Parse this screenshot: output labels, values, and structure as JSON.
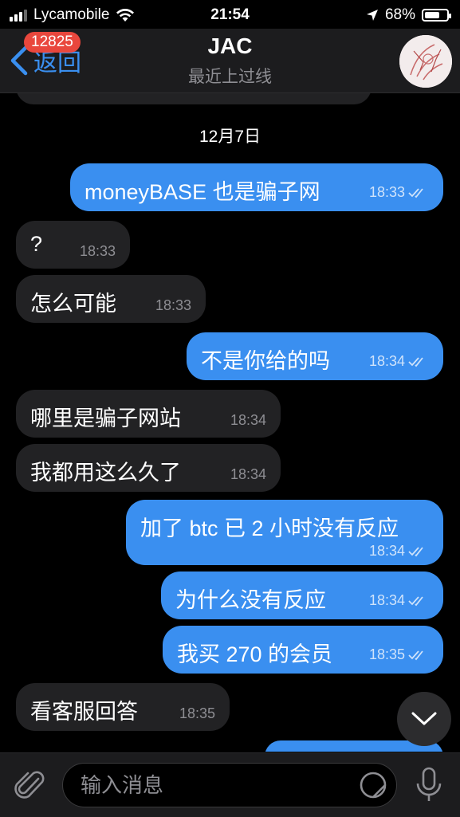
{
  "status": {
    "carrier": "Lycamobile",
    "time": "21:54",
    "battery": "68%",
    "battery_level": 0.68
  },
  "header": {
    "back_label": "返回",
    "unread_count": "12825",
    "title": "JAC",
    "subtitle": "最近上过线"
  },
  "date_separator": "12月7日",
  "messages": [
    {
      "dir": "out",
      "text": "moneyBASE 也是骗子网",
      "time": "18:33",
      "read": true
    },
    {
      "dir": "in",
      "text": "?",
      "time": "18:33"
    },
    {
      "dir": "in",
      "text": "怎么可能",
      "time": "18:33"
    },
    {
      "dir": "out",
      "text": "不是你给的吗",
      "time": "18:34",
      "read": true
    },
    {
      "dir": "in",
      "text": "哪里是骗子网站",
      "time": "18:34"
    },
    {
      "dir": "in",
      "text": "我都用这么久了",
      "time": "18:34"
    },
    {
      "dir": "out",
      "text": "加了 btc 已 2 小时没有反应",
      "time": "18:34",
      "read": true
    },
    {
      "dir": "out",
      "text": "为什么没有反应",
      "time": "18:34",
      "read": true
    },
    {
      "dir": "out",
      "text": "我买 270 的会员",
      "time": "18:35",
      "read": true
    },
    {
      "dir": "in",
      "text": "看客服回答",
      "time": "18:35"
    }
  ],
  "composer": {
    "placeholder": "输入消息"
  },
  "icons": {
    "back": "chevron-left-icon",
    "attach": "paperclip-icon",
    "sticker": "sticker-icon",
    "mic": "microphone-icon",
    "scroll_down": "chevron-down-icon"
  },
  "colors": {
    "accent": "#3a8ff0",
    "badge": "#e9473d",
    "incoming_bubble": "#222224",
    "background": "#000000"
  }
}
